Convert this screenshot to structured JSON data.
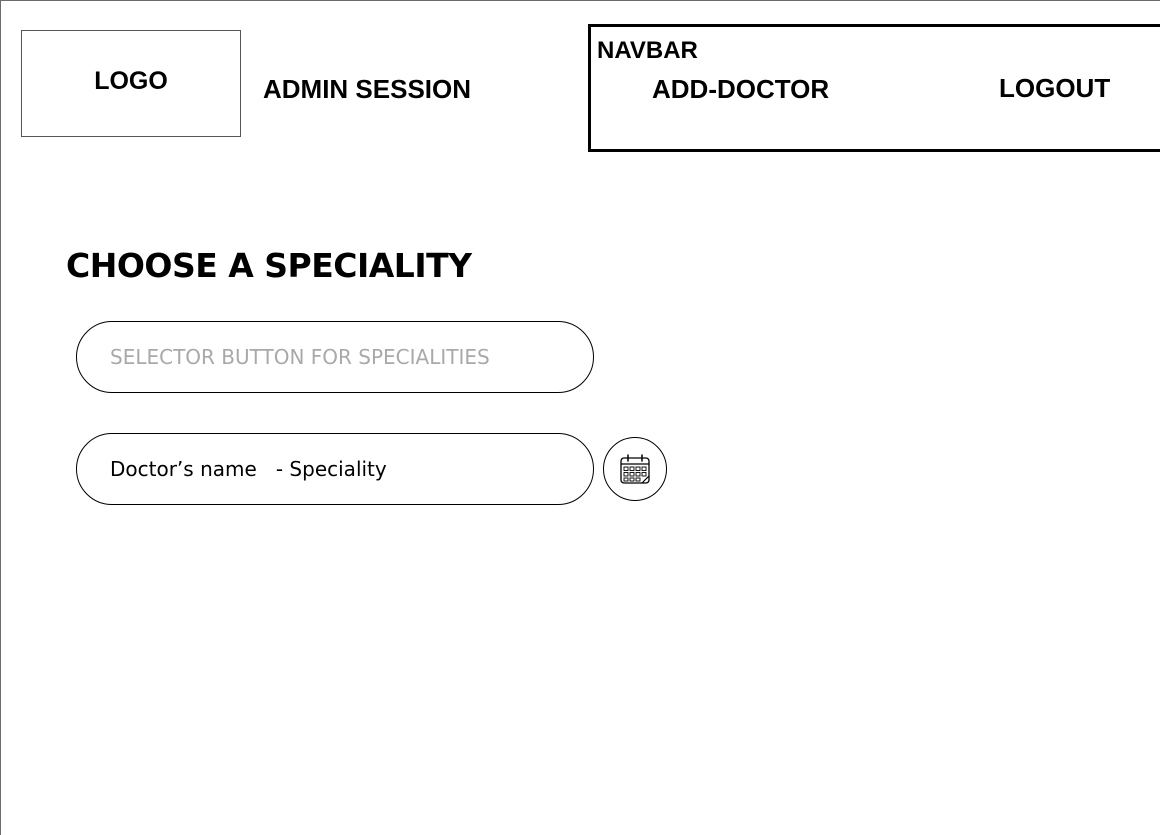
{
  "header": {
    "logo_text": "LOGO",
    "session_title": "ADMIN SESSION"
  },
  "navbar": {
    "label": "NAVBAR",
    "add_doctor": "ADD-DOCTOR",
    "logout": "LOGOUT"
  },
  "main": {
    "heading": "CHOOSE A SPECIALITY",
    "selector_placeholder": "SELECTOR BUTTON FOR SPECIALITIES",
    "doctor_row": "Doctor’s name   - Speciality",
    "calendar_icon": "calendar-icon"
  }
}
